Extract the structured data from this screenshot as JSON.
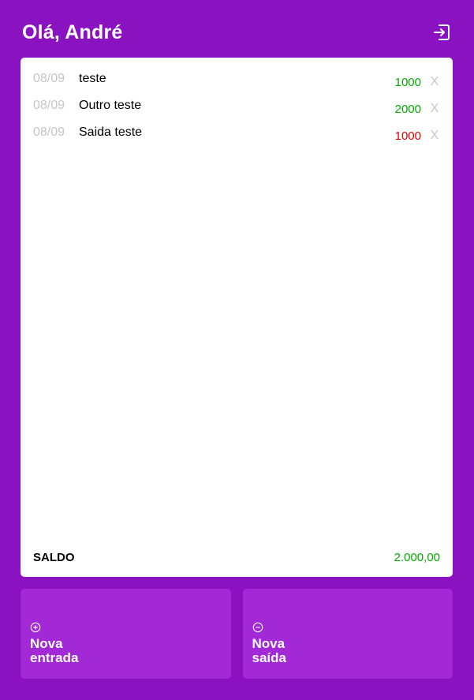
{
  "header": {
    "greeting": "Olá, André",
    "logout_icon": "logout-icon"
  },
  "records": [
    {
      "date": "08/09",
      "description": "teste",
      "value": "1000",
      "type": "in",
      "delete": "X"
    },
    {
      "date": "08/09",
      "description": "Outro teste",
      "value": "2000",
      "type": "in",
      "delete": "X"
    },
    {
      "date": "08/09",
      "description": "Saida teste",
      "value": "1000",
      "type": "out",
      "delete": "X"
    }
  ],
  "balance": {
    "label": "SALDO",
    "value": "2.000,00"
  },
  "actions": {
    "new_entry": {
      "label": "Nova entrada",
      "icon": "plus-circle-icon"
    },
    "new_exit": {
      "label": "Nova saída",
      "icon": "minus-circle-icon"
    }
  },
  "colors": {
    "background": "#8b12c0",
    "button": "#a328d6",
    "positive": "#03ac00",
    "negative": "#e00000"
  }
}
